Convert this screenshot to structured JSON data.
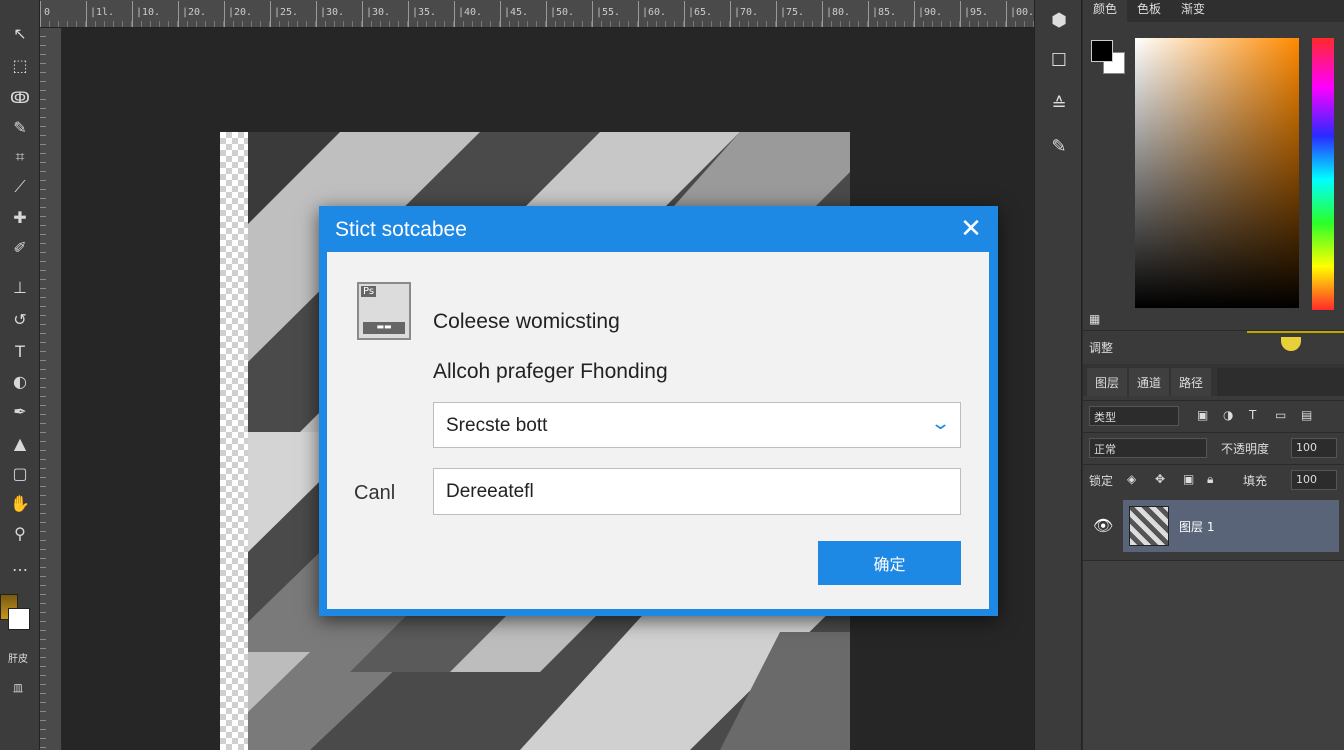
{
  "ruler": {
    "ticks": [
      "0",
      "|1l.",
      "|10.",
      "|20.",
      "|20.",
      "|25.",
      "|30.",
      "|30.",
      "|35.",
      "|40.",
      "|45.",
      "|50.",
      "|55.",
      "|60.",
      "|65.",
      "|70.",
      "|75.",
      "|80.",
      "|85.",
      "|90.",
      "|95.",
      "|00."
    ]
  },
  "toolbar": {
    "fg_label": "肝皮",
    "extra_label": "皿"
  },
  "side_icons": [
    "⬢",
    "☐",
    "≙",
    "✎"
  ],
  "panels": {
    "tabs": [
      "颜色",
      "色板",
      "渐变"
    ],
    "mini_label": "▦",
    "adjust_label": "调整",
    "layer_tabs": [
      "图层",
      "通道",
      "路径"
    ],
    "kind_select": "类型",
    "blend_select": "正常",
    "opacity_label": "不透明度",
    "opacity_value": "100",
    "lock_label": "锁定",
    "fill_label": "填充",
    "fill_value": "100",
    "layer_name": "图层 1"
  },
  "dialog": {
    "title": "Stict sotcabee",
    "close_label": "✕",
    "icon_tag": "Ps",
    "icon_bar": "▬▬",
    "message1": "Coleese womicsting",
    "message2": "Allcoh prafeger Fhonding",
    "select_value": "Srecste bott",
    "field_label": "Canl",
    "field_value": "Dereeatefl",
    "ok_label": "确定"
  },
  "colors": {
    "accent": "#1e88e5",
    "dialog_body": "#f2f2f2",
    "workspace": "#262626"
  }
}
